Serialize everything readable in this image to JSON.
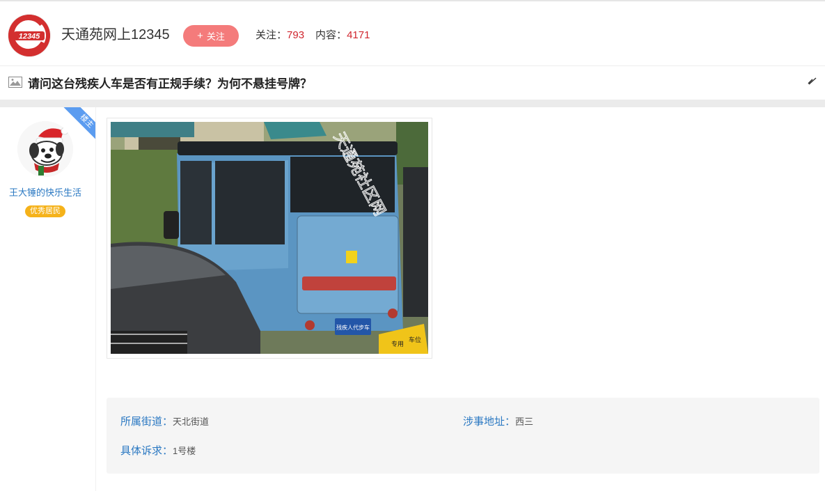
{
  "header": {
    "logo_text": "12345",
    "forum_name": "天通苑网上12345",
    "follow_label": "关注",
    "follow_icon": "plus-icon",
    "stats": {
      "follow_label": "关注：",
      "follow_count": "793",
      "content_label": "内容：",
      "content_count": "4171"
    }
  },
  "thread": {
    "title": "请问这台残疾人车是否有正规手续？为何不悬挂号牌？",
    "title_icon": "image-icon",
    "collapse_icon": "chevron-icon"
  },
  "post": {
    "ribbon_label": "楼主",
    "author": {
      "name": "王大锤的快乐生活",
      "badge": "优秀居民"
    },
    "photo": {
      "watermark": "天通苑社区网",
      "plate_text": "残疾人代步车",
      "parking_sign_text": "专用",
      "parking_sign_text2": "车位"
    },
    "details": {
      "street_label": "所属街道：",
      "street_value": "天北街道",
      "address_label": "涉事地址：",
      "address_value": "西三",
      "request_label": "具体诉求：",
      "request_value": "1号楼"
    }
  },
  "colors": {
    "accent_red": "#d0262e",
    "follow_button": "#f47b7b",
    "link_blue": "#2a78c2",
    "badge_gold": "#f5b21a",
    "ribbon_blue": "#5b9cf0"
  }
}
